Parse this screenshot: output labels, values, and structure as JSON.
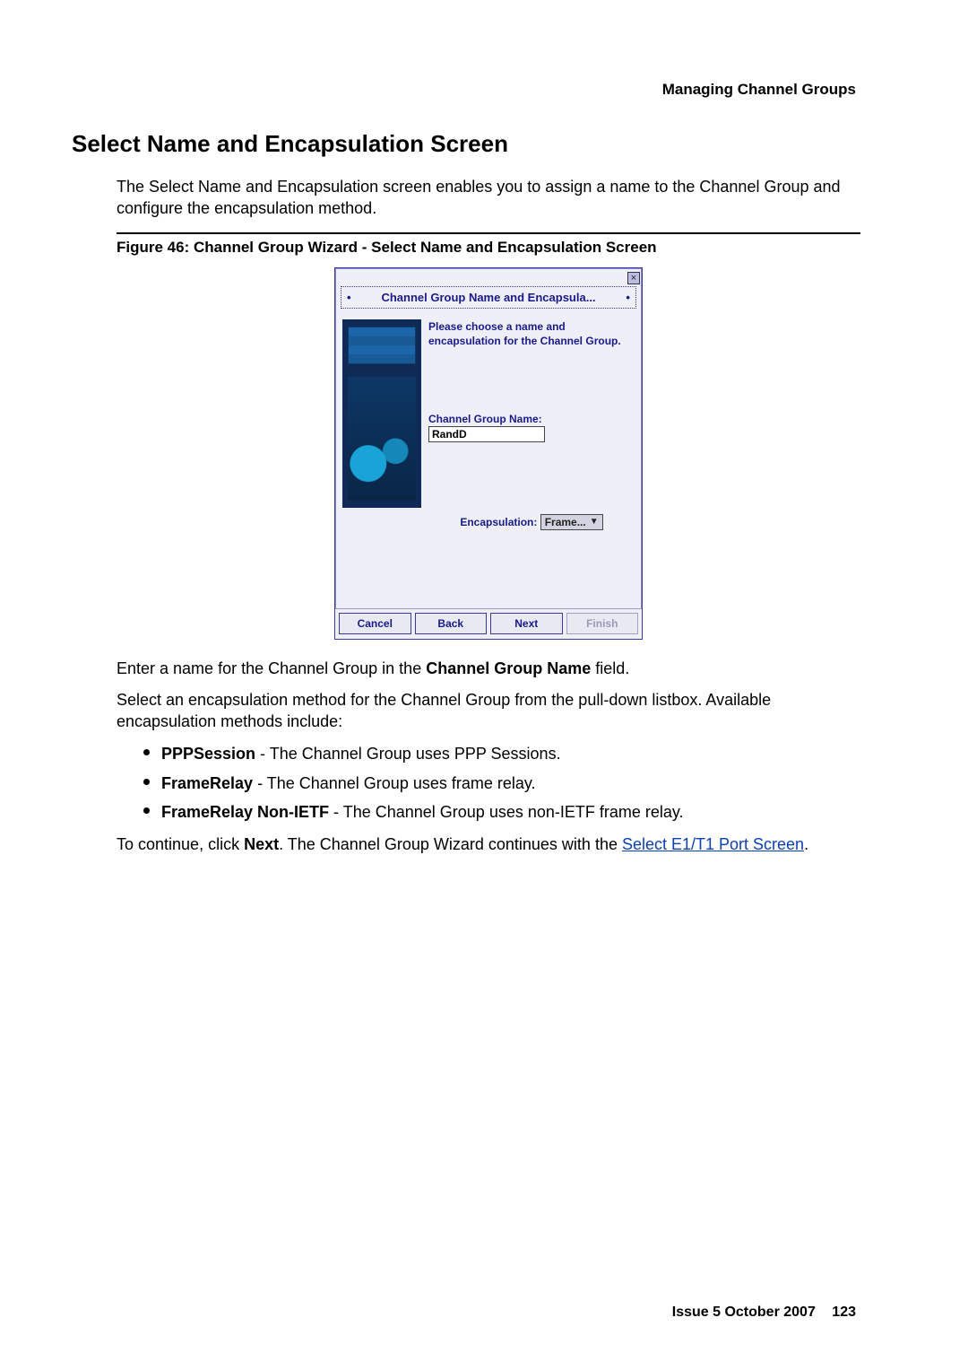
{
  "header": {
    "section": "Managing Channel Groups"
  },
  "title": "Select Name and Encapsulation Screen",
  "intro": "The Select Name and Encapsulation screen enables you to assign a name to the Channel Group and configure the encapsulation method.",
  "figure": {
    "caption": "Figure 46: Channel Group Wizard - Select Name and Encapsulation Screen"
  },
  "wizard": {
    "title_left": "•",
    "title_text": "Channel Group Name and Encapsula...",
    "title_right": "•",
    "instruction": "Please choose a name and encapsulation for the Channel Group.",
    "name_label": "Channel Group Name:",
    "name_value": "RandD",
    "encap_label": "Encapsulation:",
    "encap_value": "Frame...",
    "buttons": {
      "cancel": "Cancel",
      "back": "Back",
      "next": "Next",
      "finish": "Finish"
    }
  },
  "after1_pre": "Enter a name for the Channel Group in the ",
  "after1_bold": "Channel Group Name",
  "after1_post": " field.",
  "after2": "Select an encapsulation method for the Channel Group from the pull-down listbox. Available encapsulation methods include:",
  "list": [
    {
      "term": "PPPSession",
      "desc": " - The Channel Group uses PPP Sessions."
    },
    {
      "term": "FrameRelay",
      "desc": " - The Channel Group uses frame relay."
    },
    {
      "term": "FrameRelay Non-IETF",
      "desc": " - The Channel Group uses non-IETF frame relay."
    }
  ],
  "cont_pre": "To continue, click ",
  "cont_bold": "Next",
  "cont_mid": ". The Channel Group Wizard continues with the ",
  "cont_link": "Select E1/T1 Port Screen",
  "cont_post": ".",
  "footer": {
    "issue": "Issue 5   October 2007",
    "page": "123"
  }
}
